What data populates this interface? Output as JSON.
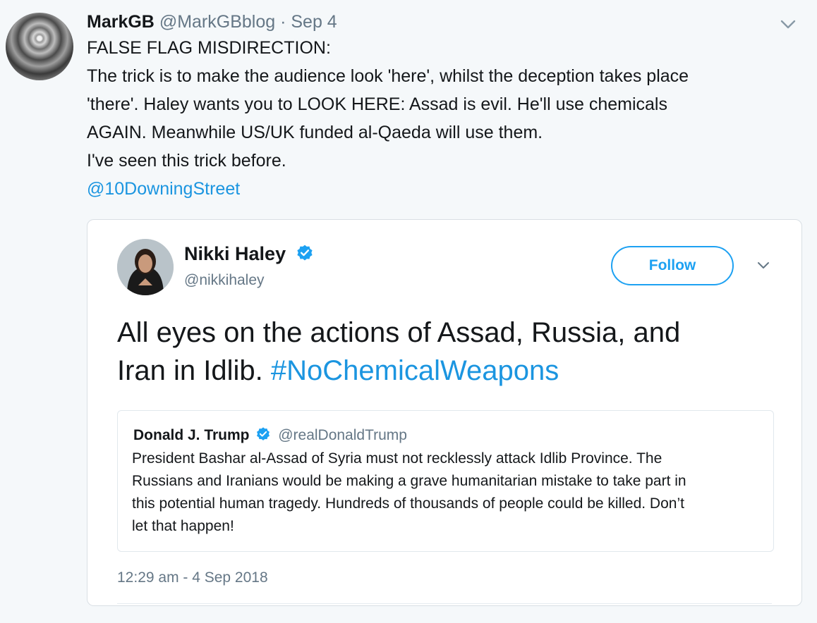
{
  "tweet": {
    "author_name": "MarkGB",
    "author_handle": "@MarkGBblog",
    "separator": " · ",
    "date": "Sep 4",
    "lines": [
      "FALSE FLAG MISDIRECTION:",
      "The trick is to make the audience look 'here', whilst the deception takes place",
      "'there'. Haley wants you to LOOK HERE: Assad is evil. He'll use chemicals",
      "AGAIN. Meanwhile US/UK funded al-Qaeda will use them.",
      "I've seen this trick before."
    ],
    "mention": "@10DowningStreet"
  },
  "embed": {
    "author_name": "Nikki Haley",
    "author_handle": "@nikkihaley",
    "follow_label": "Follow",
    "text_line1": "All eyes on the actions of Assad, Russia, and",
    "text_line2_plain": "Iran in Idlib. ",
    "hashtag": "#NoChemicalWeapons",
    "timestamp": "12:29 am - 4 Sep 2018",
    "quote": {
      "author_name": "Donald J. Trump",
      "author_handle": "@realDonaldTrump",
      "lines": [
        "President Bashar al-Assad of Syria must not recklessly attack Idlib Province. The",
        "Russians and Iranians would be making a grave humanitarian mistake to take part in",
        "this potential human tragedy. Hundreds of thousands of people could be killed. Don’t",
        "let that happen!"
      ]
    }
  },
  "icons": {
    "more": "chevron-down-icon",
    "verified": "verified-badge-icon"
  },
  "colors": {
    "link": "#1b95e0",
    "accent": "#1da1f2",
    "muted": "#657786",
    "background": "#f5f8fa"
  }
}
